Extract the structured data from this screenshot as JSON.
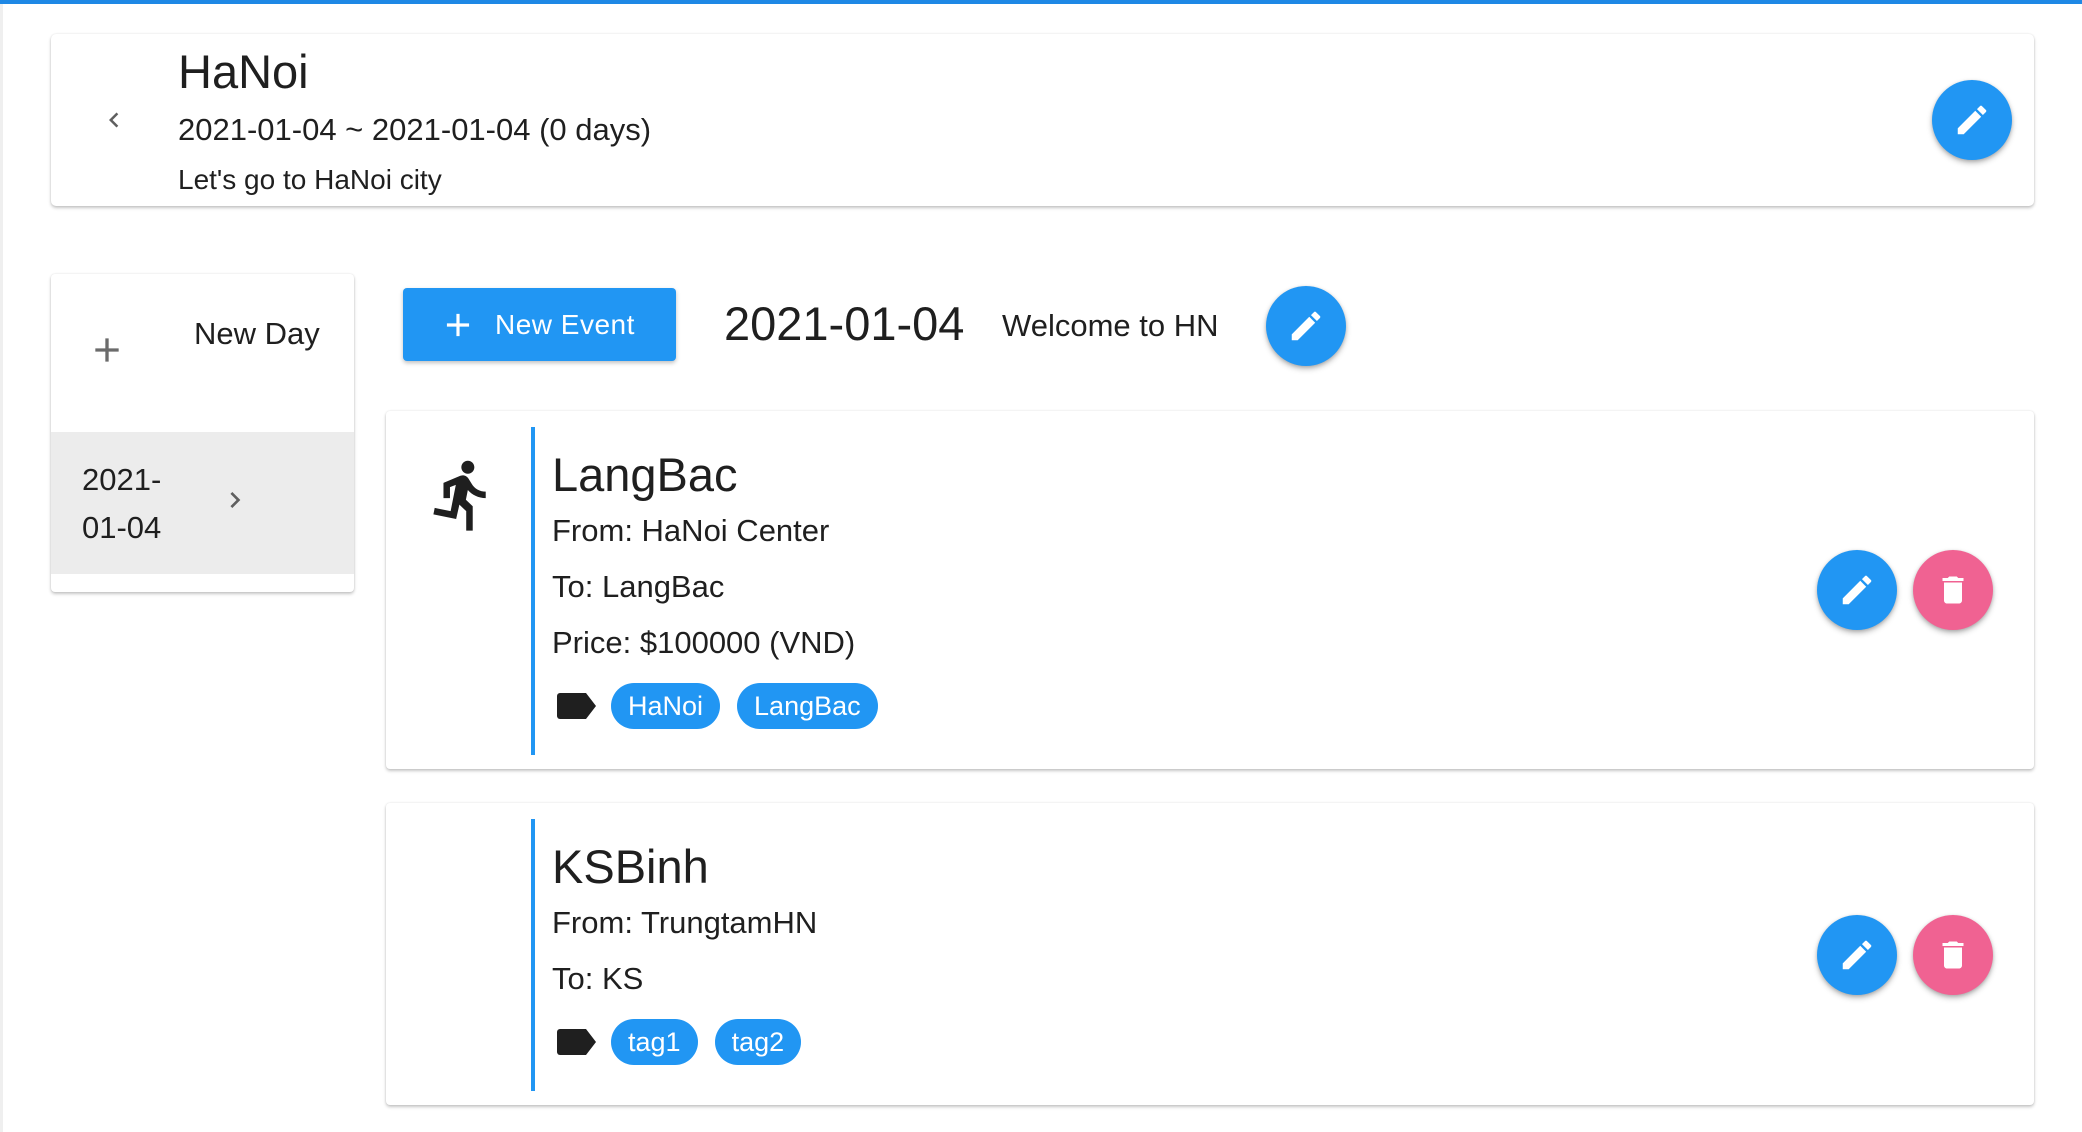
{
  "colors": {
    "accent": "#2196f3",
    "danger": "#f06292",
    "selected_bg": "#ececec"
  },
  "trip": {
    "title": "HaNoi",
    "dates": "2021-01-04 ~ 2021-01-04 (0 days)",
    "description": "Let's go to HaNoi city",
    "back_icon": "chevron-left-icon",
    "edit_icon": "pencil-icon"
  },
  "sidebar": {
    "new_day_label": "New Day",
    "new_day_icon": "plus-icon",
    "days": [
      {
        "label": "2021-01-04",
        "icon": "chevron-right-icon",
        "selected": true
      }
    ]
  },
  "day": {
    "new_event_label": "New Event",
    "date": "2021-01-04",
    "title": "Welcome to HN",
    "edit_icon": "pencil-icon"
  },
  "events": [
    {
      "type_icon": "run-icon",
      "title": "LangBac",
      "from": "From: HaNoi Center",
      "to": "To: LangBac",
      "price": "Price: $100000 (VND)",
      "tags": [
        "HaNoi",
        "LangBac"
      ],
      "edit_icon": "pencil-icon",
      "delete_icon": "trash-icon"
    },
    {
      "type_icon": "",
      "title": "KSBinh",
      "from": "From: TrungtamHN",
      "to": "To: KS",
      "tags": [
        "tag1",
        "tag2"
      ],
      "edit_icon": "pencil-icon",
      "delete_icon": "trash-icon"
    }
  ]
}
